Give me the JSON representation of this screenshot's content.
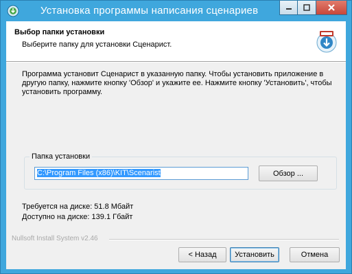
{
  "window": {
    "title": "Установка программы написания сценариев"
  },
  "header": {
    "title": "Выбор папки установки",
    "subtitle": "Выберите папку для установки Сценарист."
  },
  "body": {
    "description": "Программа установит Сценарист в указанную папку. Чтобы установить приложение в другую папку, нажмите кнопку 'Обзор' и укажите ее. Нажмите кнопку 'Установить', чтобы установить программу."
  },
  "install_folder": {
    "label": "Папка установки",
    "path": "C:\\Program Files (x86)\\KIT\\Scenarist",
    "browse_label": "Обзор ..."
  },
  "disk": {
    "required": "Требуется на диске: 51.8 Мбайт",
    "available": "Доступно на диске: 139.1 Гбайт"
  },
  "branding": "Nullsoft Install System v2.46",
  "buttons": {
    "back": "< Назад",
    "install": "Установить",
    "cancel": "Отмена"
  },
  "colors": {
    "titlebar": "#3fa7dd",
    "selection": "#3399ff",
    "close_button": "#c7473a"
  },
  "icons": {
    "app": "installer-icon",
    "logo": "installer-logo-icon",
    "minimize": "minimize-icon",
    "maximize": "maximize-icon",
    "close": "close-icon"
  }
}
